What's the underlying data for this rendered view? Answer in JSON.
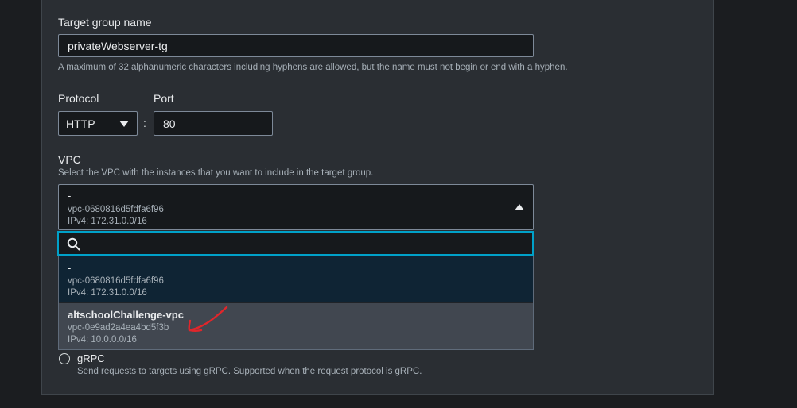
{
  "target_group": {
    "label": "Target group name",
    "value": "privateWebserver-tg",
    "help": "A maximum of 32 alphanumeric characters including hyphens are allowed, but the name must not begin or end with a hyphen."
  },
  "protocol": {
    "label": "Protocol",
    "value": "HTTP"
  },
  "port": {
    "label": "Port",
    "value": "80",
    "separator": ":"
  },
  "vpc": {
    "label": "VPC",
    "help": "Select the VPC with the instances that you want to include in the target group.",
    "selected": {
      "name": "-",
      "id": "vpc-0680816d5fdfa6f96",
      "cidr": "IPv4: 172.31.0.0/16"
    },
    "search_placeholder": "",
    "options": [
      {
        "name": "-",
        "id": "vpc-0680816d5fdfa6f96",
        "cidr": "IPv4: 172.31.0.0/16"
      },
      {
        "name": "altschoolChallenge-vpc",
        "id": "vpc-0e9ad2a4ea4bd5f3b",
        "cidr": "IPv4: 10.0.0.0/16"
      }
    ]
  },
  "grpc": {
    "label": "gRPC",
    "help": "Send requests to targets using gRPC. Supported when the request protocol is gRPC."
  },
  "colors": {
    "page_bg": "#1b1d20",
    "panel_bg": "#2a2e33",
    "input_bg": "#16191c",
    "focus_border": "#00a1c9",
    "option_selected_bg": "#0f2434",
    "option_hover_bg": "#414750",
    "annotation_arrow": "#e0262b"
  },
  "icons": {
    "dropdown_closed": "chevron-down-icon",
    "dropdown_open": "chevron-up-icon",
    "search": "search-icon",
    "annotation": "arrow-annotation-icon"
  }
}
